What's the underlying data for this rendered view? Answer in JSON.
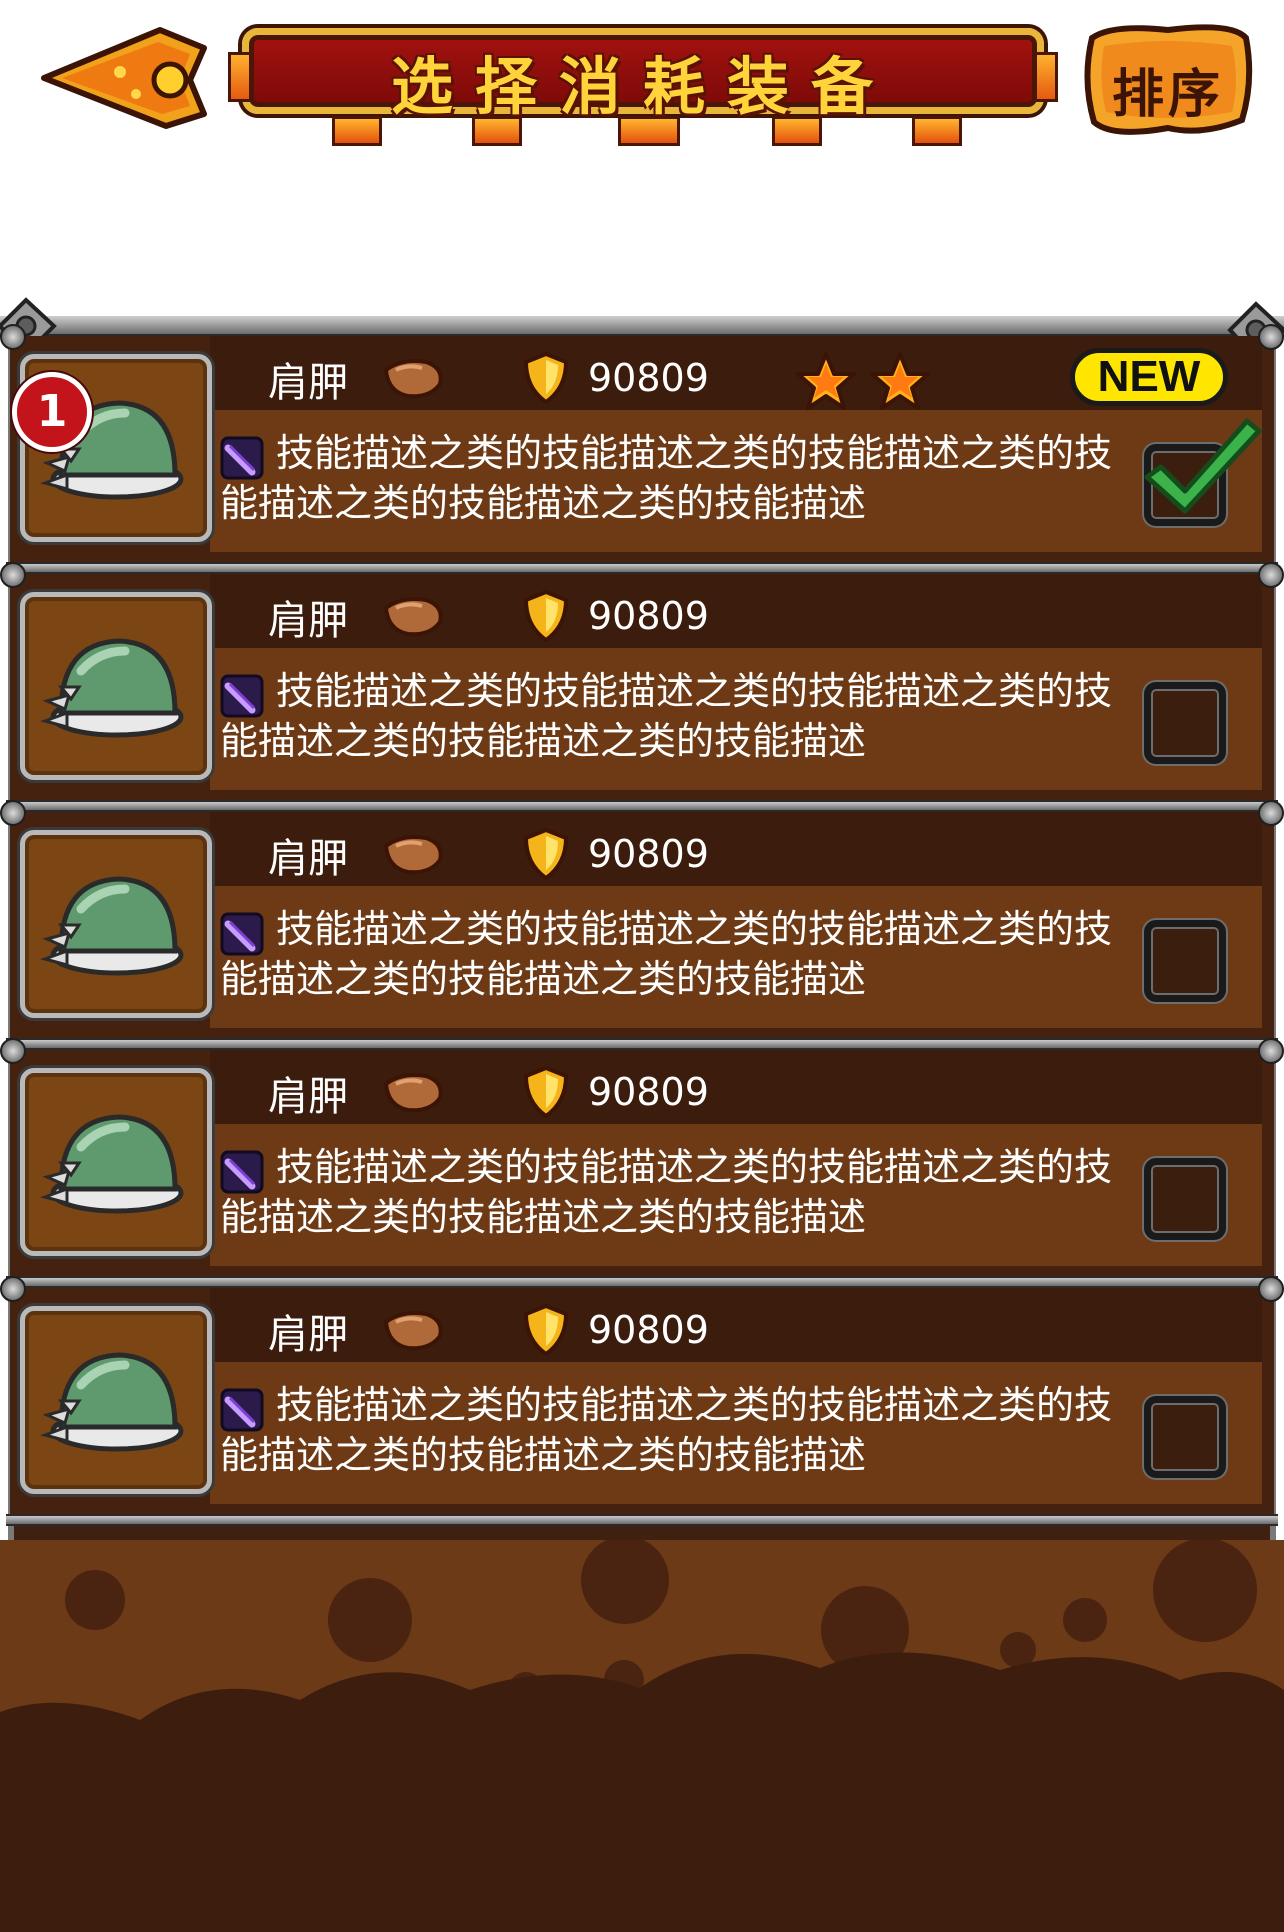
{
  "header": {
    "title": "选择消耗装备",
    "back_icon": "arrow-left-icon",
    "sort_label": "排序"
  },
  "items": [
    {
      "name": "肩胛",
      "value": "90809",
      "stars": 2,
      "is_new": true,
      "new_label": "NEW",
      "count": "1",
      "checked": true,
      "description": "技能描述之类的技能描述之类的技能描述之类的技能描述之类的技能描述之类的技能描述"
    },
    {
      "name": "肩胛",
      "value": "90809",
      "stars": 0,
      "is_new": false,
      "checked": false,
      "description": "技能描述之类的技能描述之类的技能描述之类的技能描述之类的技能描述之类的技能描述"
    },
    {
      "name": "肩胛",
      "value": "90809",
      "stars": 0,
      "is_new": false,
      "checked": false,
      "description": "技能描述之类的技能描述之类的技能描述之类的技能描述之类的技能描述之类的技能描述"
    },
    {
      "name": "肩胛",
      "value": "90809",
      "stars": 0,
      "is_new": false,
      "checked": false,
      "description": "技能描述之类的技能描述之类的技能描述之类的技能描述之类的技能描述之类的技能描述"
    },
    {
      "name": "肩胛",
      "value": "90809",
      "stars": 0,
      "is_new": false,
      "checked": false,
      "description": "技能描述之类的技能描述之类的技能描述之类的技能描述之类的技能描述之类的技能描述"
    }
  ],
  "colors": {
    "row_bg": "#45220f",
    "desc_band": "#6e3a15",
    "accent_gold": "#ffd43a",
    "title_red": "#a3120f"
  }
}
